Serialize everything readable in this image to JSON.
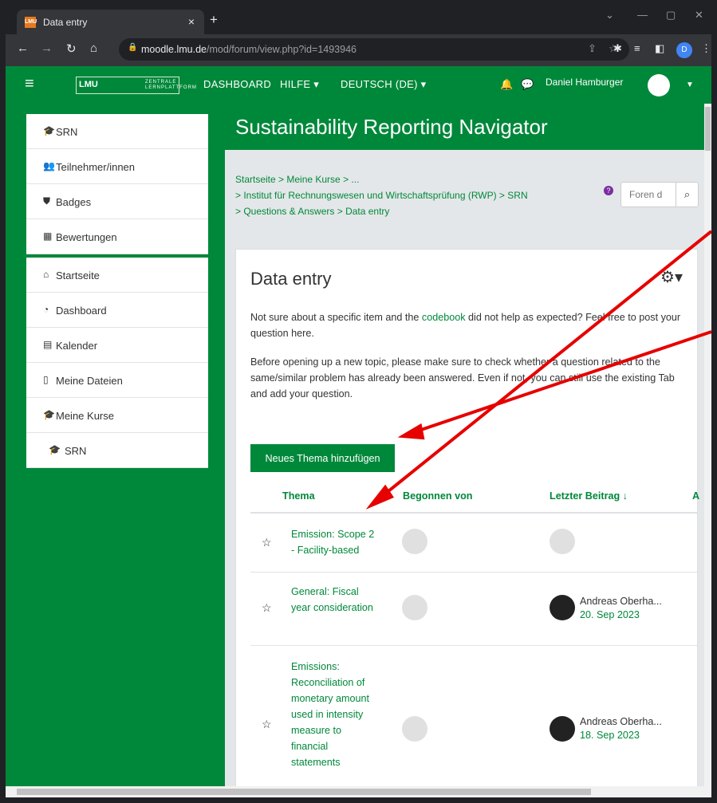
{
  "browser": {
    "tab_title": "Data entry",
    "tab_favicon": "LMU",
    "tab_close": "×",
    "new_tab": "+",
    "url_host": "moodle.lmu.de",
    "url_path": "/mod/forum/view.php?id=1493946",
    "profile_initial": "D"
  },
  "navbar": {
    "logo": "LMU",
    "logo_sub": "ZENTRALE LERNPLATTFORM",
    "menu": [
      "DASHBOARD",
      "HILFE ▾",
      "DEUTSCH (DE) ▾"
    ],
    "user_name": "Daniel Hamburger"
  },
  "drawer": {
    "course_items": [
      {
        "icon": "graduation-cap-icon",
        "glyph": "🎓",
        "label": "SRN"
      },
      {
        "icon": "users-icon",
        "glyph": "👥",
        "label": "Teilnehmer/innen"
      },
      {
        "icon": "shield-icon",
        "glyph": "⛊",
        "label": "Badges"
      },
      {
        "icon": "table-icon",
        "glyph": "▦",
        "label": "Bewertungen"
      }
    ],
    "site_items": [
      {
        "icon": "home-icon",
        "glyph": "⌂",
        "label": "Startseite"
      },
      {
        "icon": "dashboard-icon",
        "glyph": "◔",
        "label": "Dashboard"
      },
      {
        "icon": "calendar-icon",
        "glyph": "▤",
        "label": "Kalender"
      },
      {
        "icon": "file-icon",
        "glyph": "▯",
        "label": "Meine Dateien"
      },
      {
        "icon": "graduation-cap-icon",
        "glyph": "🎓",
        "label": "Meine Kurse"
      },
      {
        "icon": "graduation-cap-icon",
        "glyph": "🎓",
        "label": "SRN"
      }
    ]
  },
  "page": {
    "course_title": "Sustainability Reporting Navigator",
    "breadcrumb": {
      "line1": "Startseite  >  Meine Kurse  >  ...",
      "line2": ">  Institut für Rechnungswesen und Wirtschaftsprüfung (RWP)  >  SRN",
      "line3": ">  Questions & Answers  >  Data entry"
    },
    "search_placeholder": "Foren d",
    "forum_title": "Data entry",
    "intro1_before": "Not sure about a specific item and the ",
    "intro1_link": "codebook",
    "intro1_after": " did not help as expected? Feel free to post your question here.",
    "intro2": "Before opening up a new topic, please make sure to check whether a question related to the same/similar problem has already been answered. Even if not, you can still use the existing Tab and add your question.",
    "new_topic_button": "Neues Thema hinzufügen",
    "columns": [
      "Thema",
      "Begonnen von",
      "Letzter Beitrag ↓",
      "A"
    ],
    "topics": [
      {
        "title": "Emission: Scope 2 - Facility-based",
        "last_author": "",
        "last_date": ""
      },
      {
        "title": "General: Fiscal year consideration",
        "last_author": "Andreas Oberha...",
        "last_date": "20. Sep 2023"
      },
      {
        "title": "Emissions: Reconciliation of monetary amount used in intensity measure to financial statements",
        "last_author": "Andreas Oberha...",
        "last_date": "18. Sep 2023"
      }
    ]
  },
  "colors": {
    "accent": "#00883a",
    "annotation_arrow": "#e60000"
  }
}
